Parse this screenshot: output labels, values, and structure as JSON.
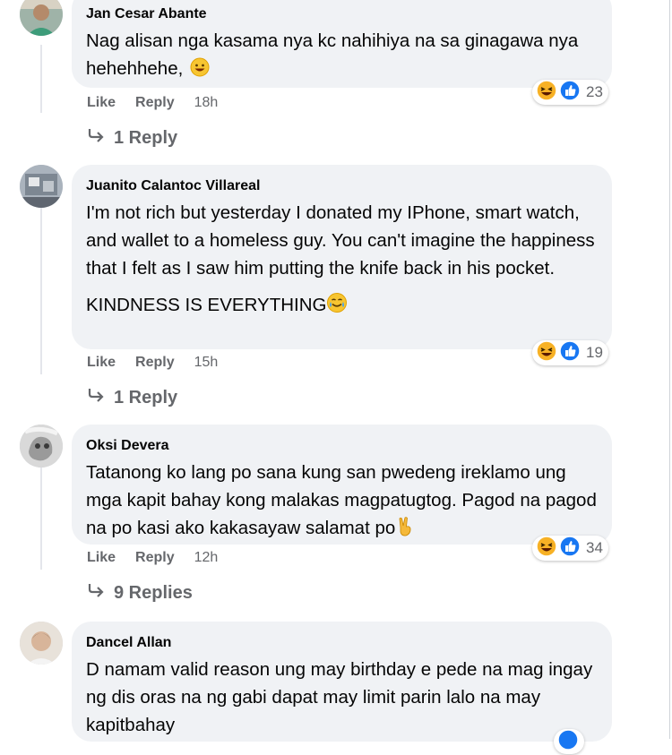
{
  "comments": [
    {
      "author": "Jan Cesar Abante",
      "text": [
        "Nag alisan nga kasama nya kc nahihiya na sa ginagawa nya hehehhehe,"
      ],
      "like_label": "Like",
      "reply_label": "Reply",
      "time": "18h",
      "reaction_count": "23",
      "replies_label": "1 Reply"
    },
    {
      "author": "Juanito Calantoc Villareal",
      "text": [
        "I'm not rich but yesterday I donated my IPhone, smart watch, and wallet to a homeless guy. You can't imagine the happiness that I felt as I saw him putting the knife back in his pocket.",
        "KINDNESS IS EVERYTHING"
      ],
      "like_label": "Like",
      "reply_label": "Reply",
      "time": "15h",
      "reaction_count": "19",
      "replies_label": "1 Reply"
    },
    {
      "author": "Oksi Devera",
      "text": [
        "Tatanong ko lang po sana kung san pwedeng ireklamo ung mga kapit bahay kong malakas magpatugtog. Pagod na pagod na po kasi ako kakasayaw salamat po"
      ],
      "like_label": "Like",
      "reply_label": "Reply",
      "time": "12h",
      "reaction_count": "34",
      "replies_label": "9 Replies"
    },
    {
      "author": "Dancel Allan",
      "text": [
        "D namam valid reason ung may birthday e pede na mag ingay ng dis oras na ng gabi dapat may limit parin lalo na may kapitbahay"
      ]
    }
  ],
  "icons": {
    "reaction_haha": "haha-reaction-icon",
    "reaction_like": "like-reaction-icon",
    "reply_arrow": "reply-arrow-icon"
  },
  "colors": {
    "bubble": "#f0f2f5",
    "meta": "#65676b",
    "like_blue": "#1877f2",
    "haha_yellow": "#f7b125"
  }
}
